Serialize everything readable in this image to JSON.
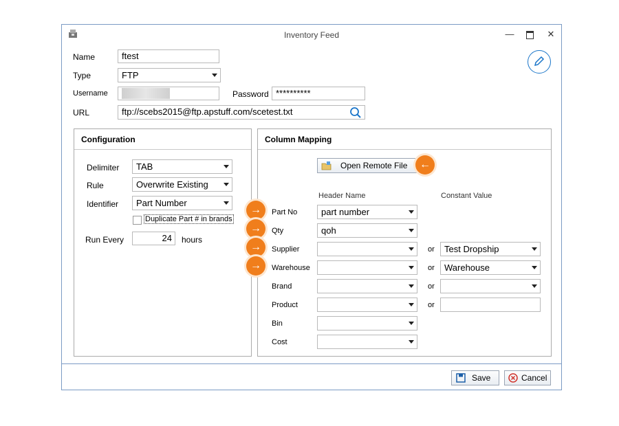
{
  "window": {
    "title": "Inventory Feed"
  },
  "top": {
    "name_label": "Name",
    "name_value": "ftest",
    "type_label": "Type",
    "type_value": "FTP",
    "username_label": "Username",
    "password_label": "Password",
    "password_value": "**********",
    "url_label": "URL",
    "url_value": "ftp://scebs2015@ftp.apstuff.com/scetest.txt"
  },
  "configuration": {
    "title": "Configuration",
    "delimiter_label": "Delimiter",
    "delimiter_value": "TAB",
    "rule_label": "Rule",
    "rule_value": "Overwrite Existing",
    "identifier_label": "Identifier",
    "identifier_value": "Part Number",
    "duplicate_label": "Duplicate Part # in brands",
    "run_every_label": "Run Every",
    "run_every_value": "24",
    "hours_label": "hours"
  },
  "mapping": {
    "title": "Column Mapping",
    "open_remote_label": "Open Remote File",
    "header_name_col": "Header Name",
    "constant_value_col": "Constant Value",
    "or_label": "or",
    "rows": [
      {
        "label": "Part No",
        "header": "part number"
      },
      {
        "label": "Qty",
        "header": "qoh"
      },
      {
        "label": "Supplier",
        "header": "",
        "constant": "Test Dropship"
      },
      {
        "label": "Warehouse",
        "header": "",
        "constant": "Warehouse"
      },
      {
        "label": "Brand",
        "header": "",
        "constant": ""
      },
      {
        "label": "Product",
        "header": "",
        "constant": ""
      },
      {
        "label": "Bin",
        "header": ""
      },
      {
        "label": "Cost",
        "header": ""
      }
    ]
  },
  "footer": {
    "save_label": "Save",
    "cancel_label": "Cancel"
  },
  "colors": {
    "accent_orange": "#f07e1c",
    "edit_blue": "#1a75c9"
  }
}
